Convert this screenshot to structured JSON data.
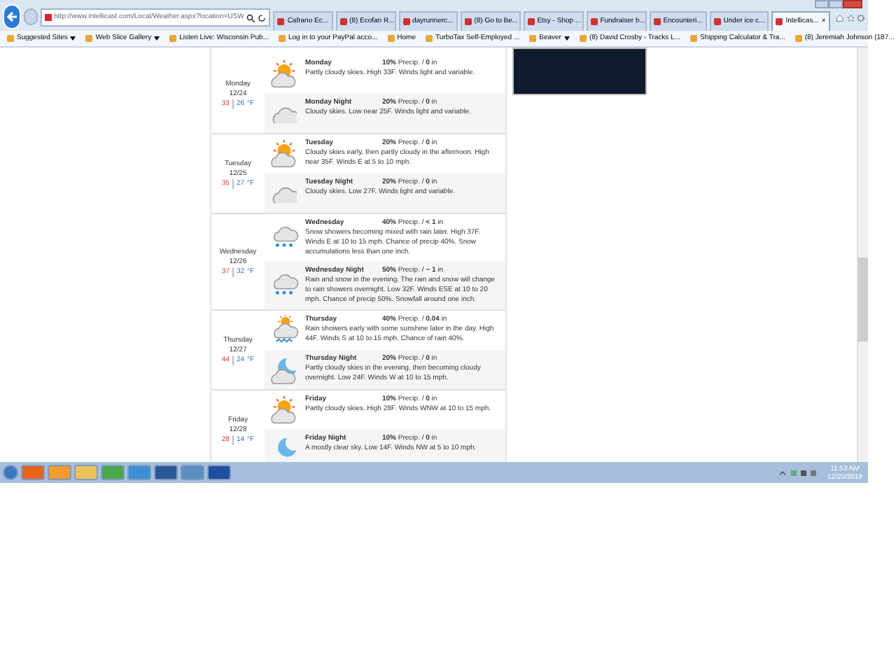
{
  "browser": {
    "url": "http://www.intellicast.com/Local/Weather.aspx?location=USW",
    "tabs": [
      {
        "label": "Cafrano Ec...",
        "selected": false
      },
      {
        "label": "(8) Ecofan R...",
        "selected": false
      },
      {
        "label": "dayrunnerc...",
        "selected": false
      },
      {
        "label": "(8) Go to Be...",
        "selected": false
      },
      {
        "label": "Etsy - Shop ...",
        "selected": false
      },
      {
        "label": "Fundraiser b...",
        "selected": false
      },
      {
        "label": "Encounteri...",
        "selected": false
      },
      {
        "label": "Under ice c...",
        "selected": false
      },
      {
        "label": "Intellicas...",
        "selected": true,
        "close": "×"
      }
    ],
    "favorites": [
      {
        "label": "Suggested Sites",
        "dropdown": true
      },
      {
        "label": "Web Slice Gallery",
        "dropdown": true
      },
      {
        "label": "Listen Live: Wisconsin Pub...",
        "dropdown": false
      },
      {
        "label": "Log in to your PayPal acco...",
        "dropdown": false
      },
      {
        "label": "Home",
        "dropdown": false
      },
      {
        "label": "TurboTax Self-Employed ...",
        "dropdown": false
      },
      {
        "label": "Beaver",
        "dropdown": true
      },
      {
        "label": "(8) David Crosby - Tracks L...",
        "dropdown": false
      },
      {
        "label": "Shipping Calculator & Tra...",
        "dropdown": false
      },
      {
        "label": "(8) Jeremiah Johnson (187...",
        "dropdown": false
      }
    ]
  },
  "forecast": [
    {
      "day": "Monday",
      "date": "12/24",
      "high": "33",
      "low": "26",
      "unit": "°F",
      "periods": [
        {
          "name": "Monday",
          "kind": "sun-cloud",
          "precip": "**10%** Precip. / **0** in",
          "text": "Partly cloudy skies. High 33F. Winds light and variable."
        },
        {
          "name": "Monday Night",
          "kind": "cloud",
          "precip": "**20%** Precip. / **0** in",
          "text": "Cloudy skies. Low near 25F. Winds light and variable."
        }
      ]
    },
    {
      "day": "Tuesday",
      "date": "12/25",
      "high": "35",
      "low": "27",
      "unit": "°F",
      "periods": [
        {
          "name": "Tuesday",
          "kind": "sun-cloud",
          "precip": "**20%** Precip. / **0** in",
          "text": "Cloudy skies early, then partly cloudy in the afternoon. High near 35F. Winds E at 5 to 10 mph."
        },
        {
          "name": "Tuesday Night",
          "kind": "cloud",
          "precip": "**20%** Precip. / **0** in",
          "text": "Cloudy skies. Low 27F. Winds light and variable."
        }
      ]
    },
    {
      "day": "Wednesday",
      "date": "12/26",
      "high": "37",
      "low": "32",
      "unit": "°F",
      "periods": [
        {
          "name": "Wednesday",
          "kind": "snow",
          "precip": "**40%** Precip. / **< 1** in",
          "text": "Snow showers becoming mixed with rain later. High 37F. Winds E at 10 to 15 mph. Chance of precip 40%. Snow accumulations less than one inch."
        },
        {
          "name": "Wednesday Night",
          "kind": "snow",
          "precip": "**50%** Precip. / **~ 1** in",
          "text": "Rain and snow in the evening. The rain and snow will change to rain showers overnight. Low 32F. Winds ESE at 10 to 20 mph. Chance of precip 50%. Snowfall around one inch."
        }
      ]
    },
    {
      "day": "Thursday",
      "date": "12/27",
      "high": "44",
      "low": "24",
      "unit": "°F",
      "periods": [
        {
          "name": "Thursday",
          "kind": "rain",
          "precip": "**40%** Precip. / **0.04** in",
          "text": "Rain showers early with some sunshine later in the day. High 44F. Winds S at 10 to 15 mph. Chance of rain 40%."
        },
        {
          "name": "Thursday Night",
          "kind": "moon-cloud",
          "precip": "**20%** Precip. / **0** in",
          "text": "Partly cloudy skies in the evening, then becoming cloudy overnight. Low 24F. Winds W at 10 to 15 mph."
        }
      ]
    },
    {
      "day": "Friday",
      "date": "12/28",
      "high": "28",
      "low": "14",
      "unit": "°F",
      "periods": [
        {
          "name": "Friday",
          "kind": "sun-cloud",
          "precip": "**10%** Precip. / **0** in",
          "text": "Partly cloudy skies. High 28F. Winds WNW at 10 to 15 mph."
        },
        {
          "name": "Friday Night",
          "kind": "moon",
          "precip": "**10%** Precip. / **0** in",
          "text": "A mostly clear sky. Low 14F. Winds NW at 5 to 10 mph."
        }
      ]
    }
  ],
  "clock": {
    "time": "11:53 AM",
    "date": "12/20/2018"
  }
}
